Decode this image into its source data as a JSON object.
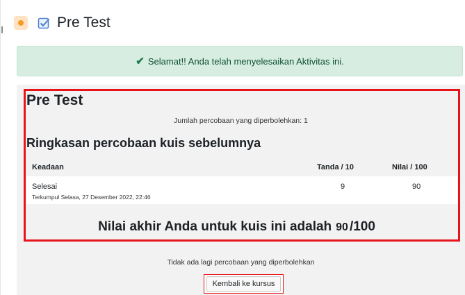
{
  "header": {
    "title": "Pre Test",
    "module_icon": "quiz-module-icon",
    "completion_icon": "checkbox-checked-icon"
  },
  "alert": {
    "icon": "check-icon",
    "message": "Selamat!! Anda telah menyelesaikan Aktivitas ini."
  },
  "quiz": {
    "title": "Pre Test",
    "attempts_allowed": "Jumlah percobaan yang diperbolehkan: 1",
    "summary_heading": "Ringkasan percobaan kuis sebelumnya",
    "columns": [
      "Keadaan",
      "Tanda / 10",
      "Nilai / 100"
    ],
    "rows": [
      {
        "state": "Selesai",
        "submitted": "Terkumpul Selasa, 27 Desember 2022, 22:46",
        "marks": "9",
        "grade": "90"
      }
    ],
    "final_grade_label": "Nilai akhir Anda untuk kuis ini adalah",
    "final_grade_value": "90",
    "final_grade_max": "/100",
    "no_more_attempts": "Tidak ada lagi percobaan yang diperbolehkan",
    "back_button": "Kembali ke kursus"
  },
  "colors": {
    "highlight": "#e8141b",
    "alert_bg": "#d7ede2",
    "alert_text": "#0f5132"
  }
}
